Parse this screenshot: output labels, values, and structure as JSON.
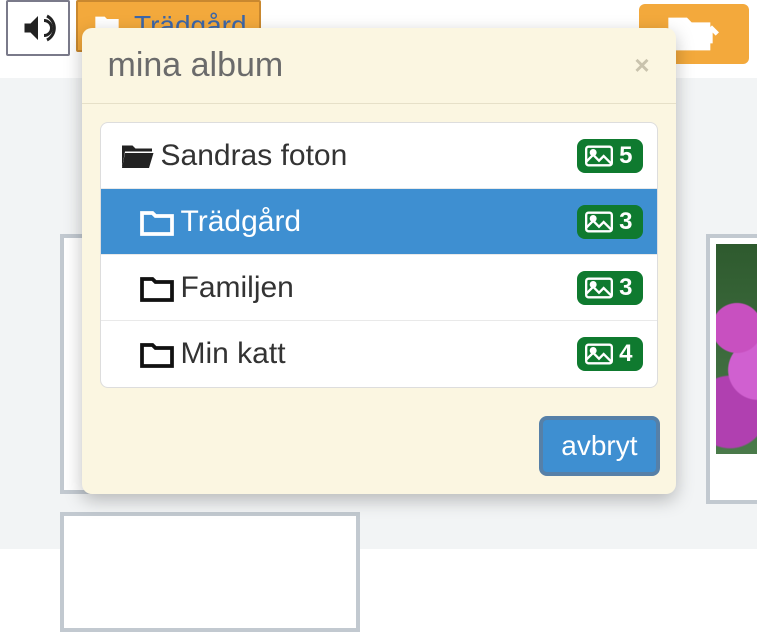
{
  "background": {
    "current_album_label": "Trädgård"
  },
  "modal": {
    "title": "mina album",
    "cancel_label": "avbryt",
    "albums": [
      {
        "label": "Sandras foton",
        "count": "5",
        "open": true,
        "child": false,
        "selected": false
      },
      {
        "label": "Trädgård",
        "count": "3",
        "open": false,
        "child": true,
        "selected": true
      },
      {
        "label": "Familjen",
        "count": "3",
        "open": false,
        "child": true,
        "selected": false
      },
      {
        "label": "Min katt",
        "count": "4",
        "open": false,
        "child": true,
        "selected": false
      }
    ]
  }
}
